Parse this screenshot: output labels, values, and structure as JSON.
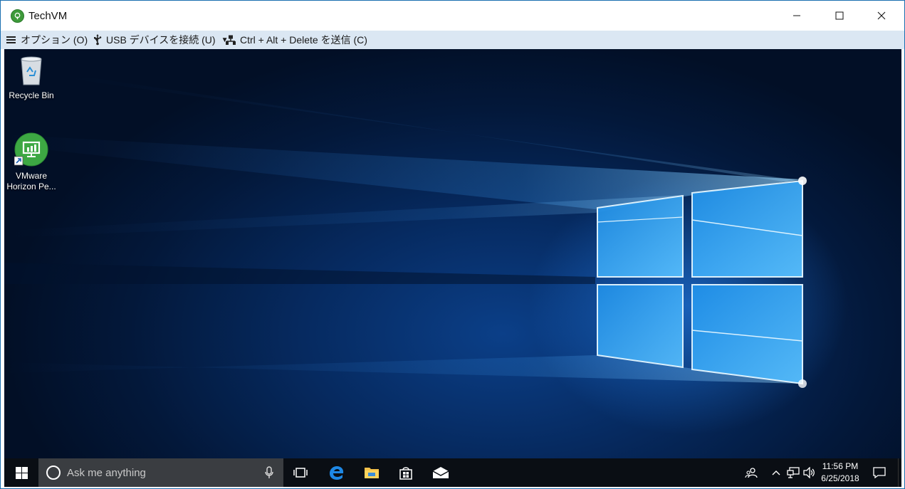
{
  "window": {
    "title": "TechVM"
  },
  "toolbar": {
    "options_label": "オプション (O)",
    "usb_label": "USB デバイスを接続 (U)",
    "cad_label": "Ctrl + Alt + Delete を送信 (C)"
  },
  "desktop": {
    "icons": [
      {
        "label": "Recycle Bin",
        "icon": "recycle-bin-icon"
      },
      {
        "label": "VMware Horizon Pe...",
        "icon": "vmware-horizon-icon"
      }
    ]
  },
  "taskbar": {
    "search_placeholder": "Ask me anything",
    "apps": [
      "task-view-icon",
      "edge-icon",
      "file-explorer-icon",
      "store-icon",
      "mail-icon"
    ],
    "clock_time": "11:56 PM",
    "clock_date": "6/25/2018"
  },
  "colors": {
    "toolbar_bg": "#dbe7f3",
    "taskbar_bg": "#0a0e14",
    "search_bg": "#3a3d41",
    "desktop_blue": "#0b3f88",
    "app_icon_green": "#3e9a3a"
  }
}
